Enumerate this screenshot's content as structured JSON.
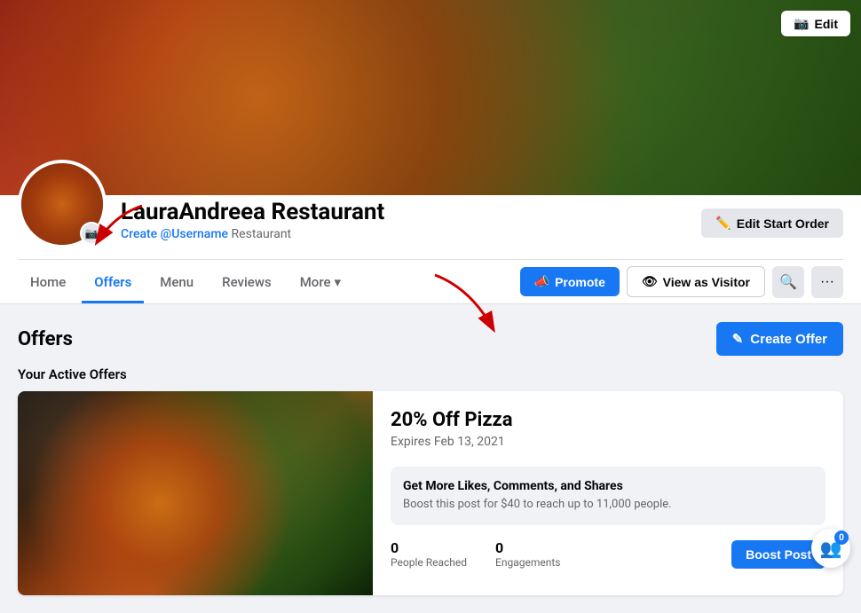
{
  "cover": {
    "edit_label": "Edit"
  },
  "profile": {
    "name": "LauraAndreea Restaurant",
    "username_label": "Create @Username",
    "category": "Restaurant",
    "edit_start_order_label": "Edit Start Order"
  },
  "nav": {
    "tabs": [
      {
        "label": "Home",
        "active": false
      },
      {
        "label": "Offers",
        "active": true
      },
      {
        "label": "Menu",
        "active": false
      },
      {
        "label": "Reviews",
        "active": false
      },
      {
        "label": "More",
        "active": false
      }
    ],
    "promote_label": "Promote",
    "view_visitor_label": "View as Visitor"
  },
  "offers_section": {
    "title": "Offers",
    "active_offers_label": "Your Active Offers",
    "create_offer_label": "Create Offer"
  },
  "offer_card": {
    "name": "20% Off Pizza",
    "expiry": "Expires Feb 13, 2021",
    "boost_title": "Get More Likes, Comments, and Shares",
    "boost_desc": "Boost this post for $40 to reach up to 11,000 people.",
    "people_reached_count": "0",
    "people_reached_label": "People Reached",
    "engagements_count": "0",
    "engagements_label": "Engagements",
    "boost_post_label": "Boost Post"
  },
  "floating": {
    "badge_count": "0"
  }
}
